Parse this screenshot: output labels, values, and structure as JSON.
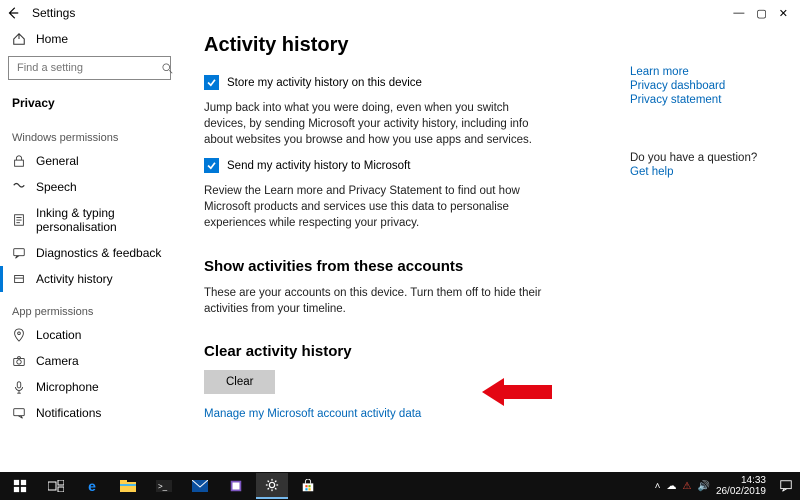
{
  "titlebar": {
    "title": "Settings"
  },
  "sidebar": {
    "home": "Home",
    "search_placeholder": "Find a setting",
    "current_section": "Privacy",
    "group1_label": "Windows permissions",
    "group1_items": [
      {
        "label": "General"
      },
      {
        "label": "Speech"
      },
      {
        "label": "Inking & typing personalisation"
      },
      {
        "label": "Diagnostics & feedback"
      },
      {
        "label": "Activity history"
      }
    ],
    "group2_label": "App permissions",
    "group2_items": [
      {
        "label": "Location"
      },
      {
        "label": "Camera"
      },
      {
        "label": "Microphone"
      },
      {
        "label": "Notifications"
      }
    ]
  },
  "main": {
    "heading": "Activity history",
    "check1": "Store my activity history on this device",
    "para1": "Jump back into what you were doing, even when you switch devices, by sending Microsoft your activity history, including info about websites you browse and how you use apps and services.",
    "check2": "Send my activity history to Microsoft",
    "para2": "Review the Learn more and Privacy Statement to find out how Microsoft products and services use this data to personalise experiences while respecting your privacy.",
    "accounts_heading": "Show activities from these accounts",
    "accounts_para": "These are your accounts on this device. Turn them off to hide their activities from your timeline.",
    "clear_heading": "Clear activity history",
    "clear_button": "Clear",
    "manage_link": "Manage my Microsoft account activity data"
  },
  "right": {
    "learn_more": "Learn more",
    "privacy_dashboard": "Privacy dashboard",
    "privacy_statement": "Privacy statement",
    "question_label": "Do you have a question?",
    "get_help": "Get help"
  },
  "taskbar": {
    "time": "14:33",
    "date": "26/02/2019"
  }
}
